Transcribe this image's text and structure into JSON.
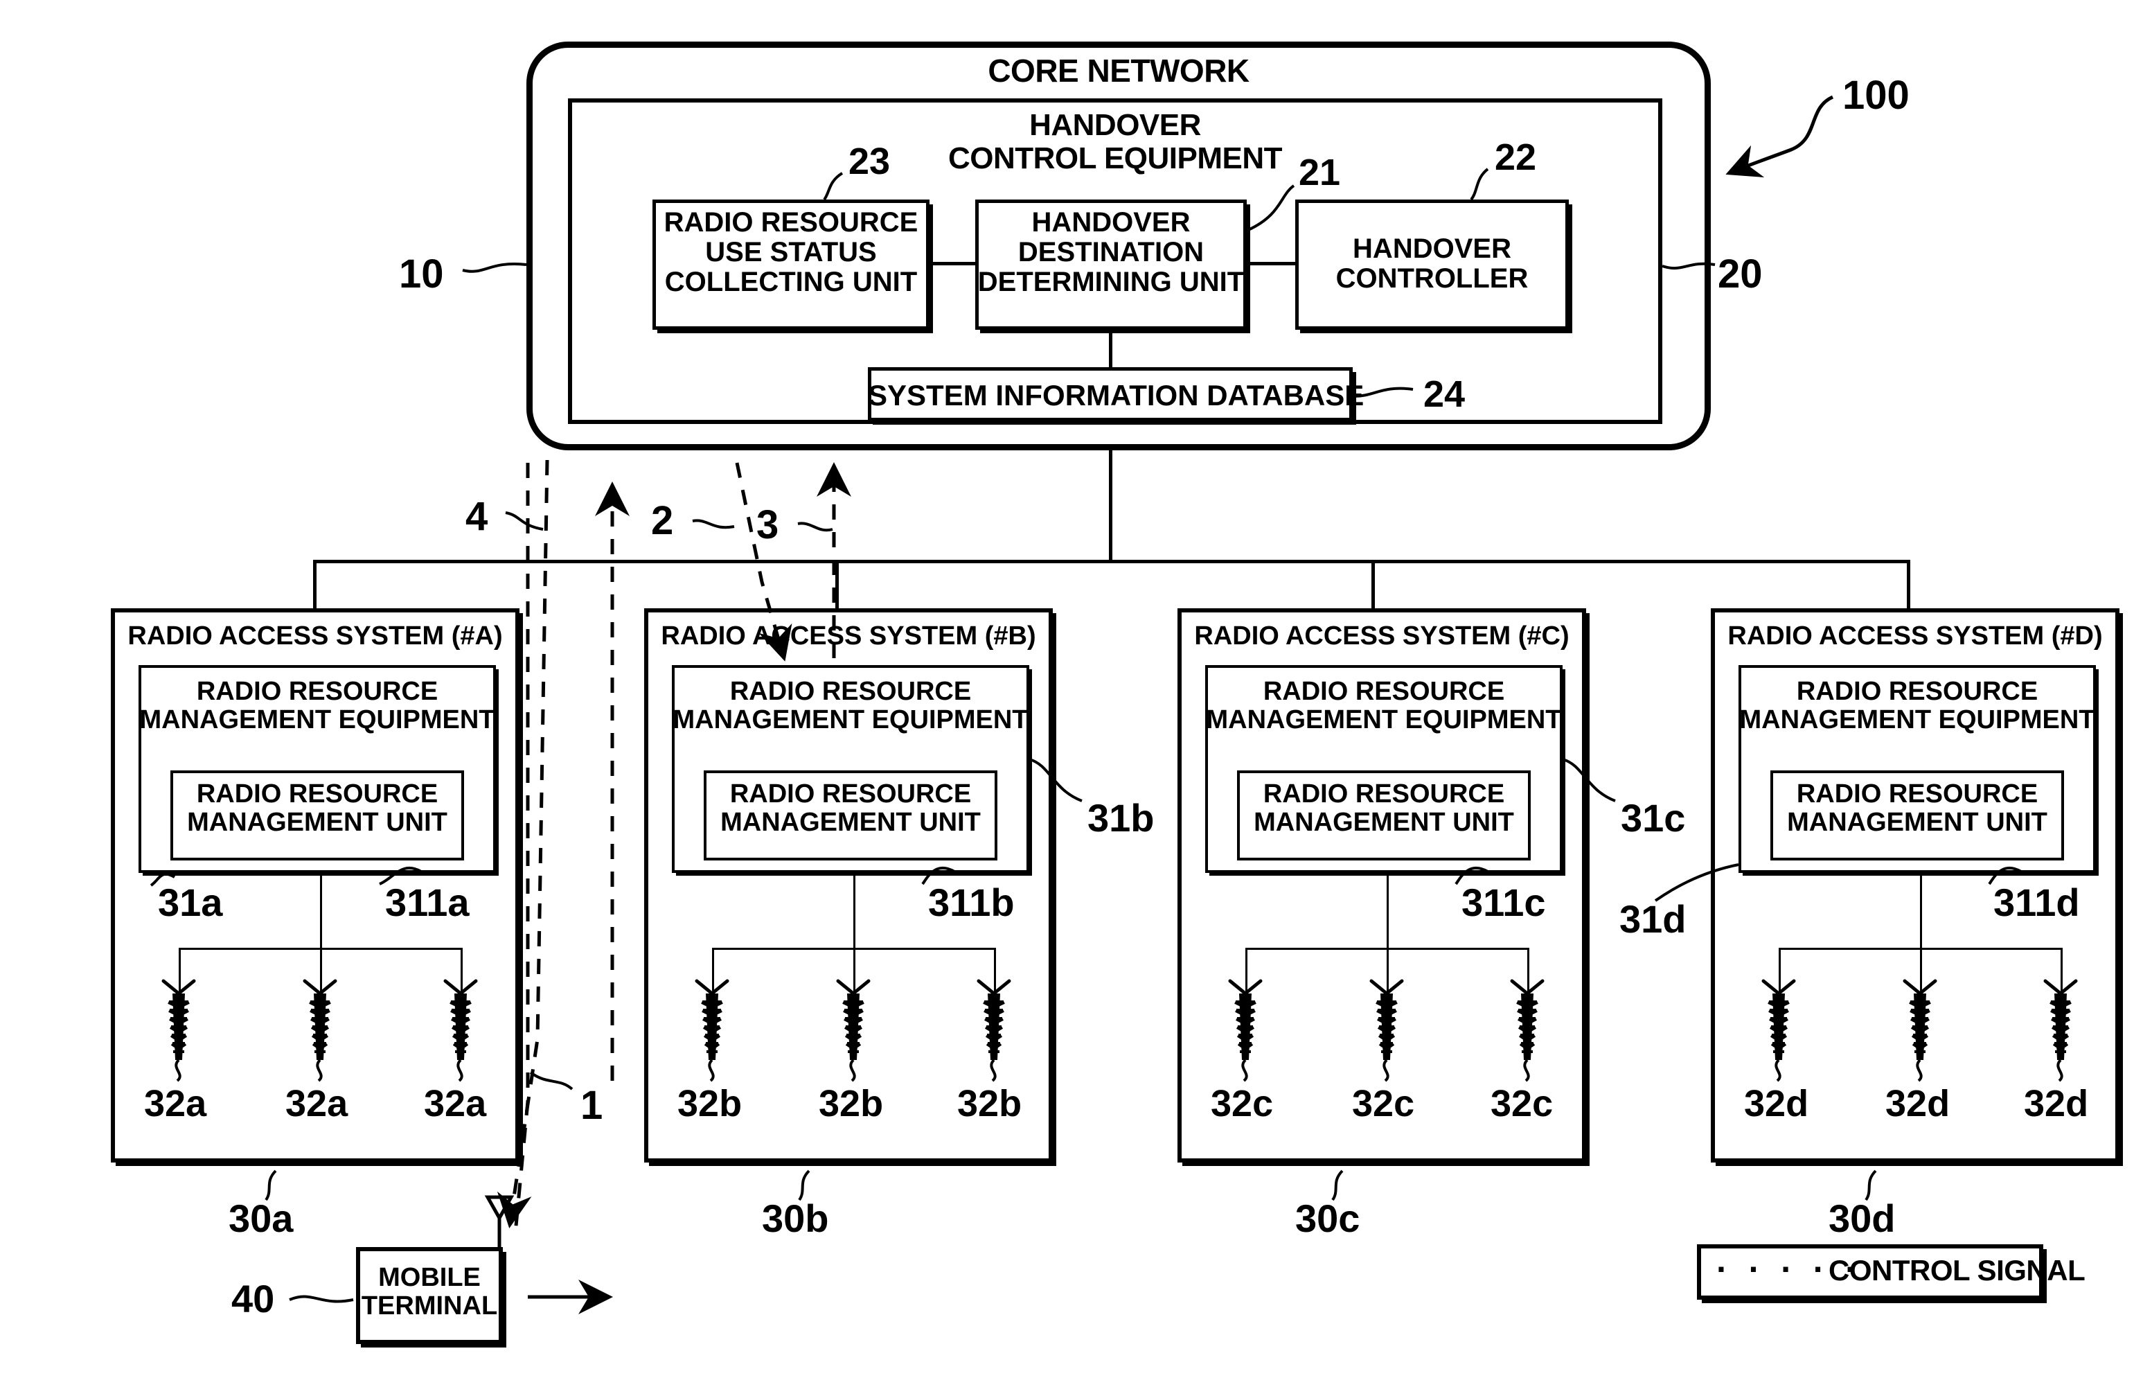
{
  "figure": {
    "core_network": {
      "title": "CORE NETWORK",
      "ref": "100",
      "outer_ref": "10",
      "inner_ref": "20"
    },
    "handover_equipment": {
      "title_line1": "HANDOVER",
      "title_line2": "CONTROL EQUIPMENT",
      "blocks": [
        {
          "ref": "23",
          "lines": [
            "RADIO RESOURCE",
            "USE STATUS",
            "COLLECTING UNIT"
          ]
        },
        {
          "ref": "21",
          "lines": [
            "HANDOVER",
            "DESTINATION",
            "DETERMINING UNIT"
          ]
        },
        {
          "ref": "22",
          "lines": [
            "HANDOVER",
            "CONTROLLER"
          ]
        }
      ],
      "database": {
        "ref": "24",
        "label": "SYSTEM INFORMATION DATABASE"
      }
    },
    "signal_refs": [
      {
        "id": "4"
      },
      {
        "id": "2"
      },
      {
        "id": "3"
      },
      {
        "id": "1"
      }
    ],
    "radio_access_systems": [
      {
        "title": "RADIO ACCESS SYSTEM (#A)",
        "system_ref": "30a",
        "equipment_lines": [
          "RADIO RESOURCE",
          "MANAGEMENT EQUIPMENT"
        ],
        "equipment_ref": "31a",
        "unit_lines": [
          "RADIO RESOURCE",
          "MANAGEMENT UNIT"
        ],
        "unit_ref": "311a",
        "antenna_refs": [
          "32a",
          "32a",
          "32a"
        ]
      },
      {
        "title": "RADIO ACCESS SYSTEM (#B)",
        "system_ref": "30b",
        "equipment_lines": [
          "RADIO RESOURCE",
          "MANAGEMENT EQUIPMENT"
        ],
        "equipment_ref": "31b",
        "unit_lines": [
          "RADIO RESOURCE",
          "MANAGEMENT UNIT"
        ],
        "unit_ref": "311b",
        "antenna_refs": [
          "32b",
          "32b",
          "32b"
        ]
      },
      {
        "title": "RADIO ACCESS SYSTEM (#C)",
        "system_ref": "30c",
        "equipment_lines": [
          "RADIO RESOURCE",
          "MANAGEMENT EQUIPMENT"
        ],
        "equipment_ref": "31c",
        "unit_lines": [
          "RADIO RESOURCE",
          "MANAGEMENT UNIT"
        ],
        "unit_ref": "311c",
        "antenna_refs": [
          "32c",
          "32c",
          "32c"
        ]
      },
      {
        "title": "RADIO ACCESS SYSTEM (#D)",
        "system_ref": "30d",
        "equipment_lines": [
          "RADIO RESOURCE",
          "MANAGEMENT EQUIPMENT"
        ],
        "equipment_ref": "31d",
        "unit_lines": [
          "RADIO RESOURCE",
          "MANAGEMENT UNIT"
        ],
        "unit_ref": "311d",
        "antenna_refs": [
          "32d",
          "32d",
          "32d"
        ]
      }
    ],
    "mobile_terminal": {
      "ref": "40",
      "line1": "MOBILE",
      "line2": "TERMINAL"
    },
    "legend": {
      "dots": "· · · · ·",
      "label": "CONTROL SIGNAL"
    }
  }
}
